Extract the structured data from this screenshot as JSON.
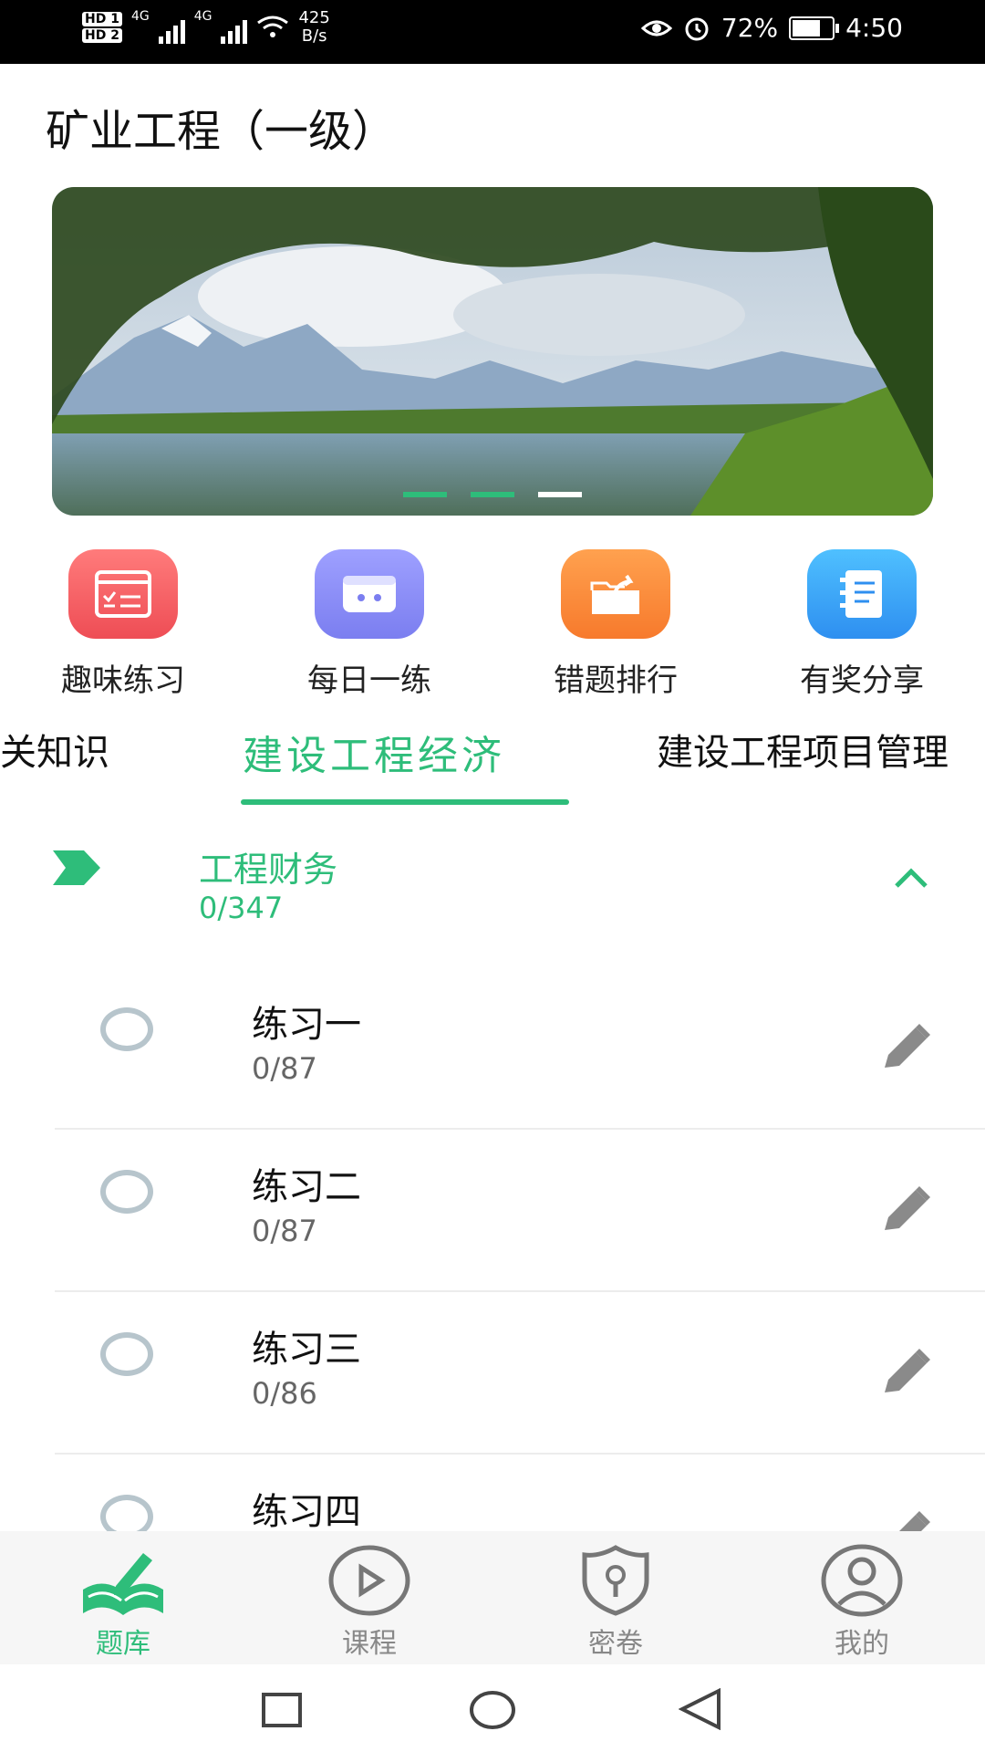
{
  "status_bar": {
    "hd1": "HD 1",
    "hd2": "HD 2",
    "sim1": "4G",
    "sim2": "4G",
    "net_speed_value": "425",
    "net_speed_unit": "B/s",
    "battery": "72%",
    "time": "4:50"
  },
  "header": {
    "title": "矿业工程（一级）"
  },
  "banner": {
    "dots_count": 3,
    "active_dot": 2
  },
  "quick_actions": [
    {
      "label": "趣味练习",
      "icon": "checklist-icon",
      "color": "#f25c5c"
    },
    {
      "label": "每日一练",
      "icon": "calendar-icon",
      "color": "#8a8cf5"
    },
    {
      "label": "错题排行",
      "icon": "folder-share-icon",
      "color": "#fb8a3c"
    },
    {
      "label": "有奖分享",
      "icon": "notebook-icon",
      "color": "#3aa7f5"
    }
  ],
  "tabs": [
    {
      "label": "相关知识",
      "active": false
    },
    {
      "label": "建设工程经济",
      "active": true
    },
    {
      "label": "建设工程项目管理",
      "active": false
    }
  ],
  "section": {
    "title": "工程财务",
    "count": "0/347",
    "color": "#2ebd7a"
  },
  "exercises": [
    {
      "name": "练习一",
      "count": "0/87"
    },
    {
      "name": "练习二",
      "count": "0/87"
    },
    {
      "name": "练习三",
      "count": "0/86"
    },
    {
      "name": "练习四",
      "count": ""
    }
  ],
  "bottom_nav": [
    {
      "label": "题库",
      "icon": "book-pen-icon",
      "active": true
    },
    {
      "label": "课程",
      "icon": "play-circle-icon",
      "active": false
    },
    {
      "label": "密卷",
      "icon": "shield-lock-icon",
      "active": false
    },
    {
      "label": "我的",
      "icon": "user-circle-icon",
      "active": false
    }
  ]
}
